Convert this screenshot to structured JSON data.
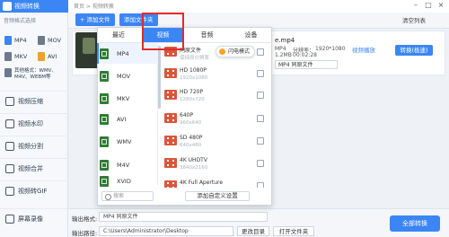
{
  "app": {
    "title": "视频转换",
    "breadcrumb": "首页 > 视频转换"
  },
  "window_controls": {
    "minimize": "–",
    "maximize": "□",
    "close": "×"
  },
  "sidebar": {
    "section_title": "音频格式选择",
    "formats": [
      {
        "label": "MP4",
        "color": "#3b86f4"
      },
      {
        "label": "MOV",
        "color": "#6c7a89"
      },
      {
        "label": "MKV",
        "color": "#6c7a89"
      },
      {
        "label": "AVI",
        "color": "#f0a030"
      },
      {
        "label": "其他格式：WMV、M4V、WEBM等",
        "color": "#6c7a89"
      }
    ],
    "nav": [
      {
        "label": "视频压缩",
        "icon": "compress-icon"
      },
      {
        "label": "视频水印",
        "icon": "watermark-icon"
      },
      {
        "label": "视频分割",
        "icon": "split-icon"
      },
      {
        "label": "视频合并",
        "icon": "merge-icon"
      },
      {
        "label": "视频转GIF",
        "icon": "gif-icon"
      },
      {
        "label": "屏幕录像",
        "icon": "record-icon"
      }
    ]
  },
  "toolbar": {
    "add_file": "+ 添加文件",
    "add_folder": "添加文件夹",
    "clear_list": "清空列表"
  },
  "file": {
    "name": "e.mp4",
    "format": "MP4",
    "resolution_label": "分辨率：",
    "resolution": "1920*1080",
    "duration": "00:02:28",
    "size": "1.2MB",
    "output_format": "MP4 同原文件",
    "play": "视频播放",
    "convert_one": "转换(极速)"
  },
  "popup": {
    "tabs": [
      "最近",
      "视频",
      "音频",
      "设备"
    ],
    "active_tab": "视频",
    "formats": [
      {
        "label": "MP4",
        "color": "#2e7d32"
      },
      {
        "label": "MOV",
        "color": "#2e7d32"
      },
      {
        "label": "MKV",
        "color": "#2e7d32"
      },
      {
        "label": "AVI",
        "color": "#2e7d32"
      },
      {
        "label": "WMV",
        "color": "#2e7d32"
      },
      {
        "label": "M4V",
        "color": "#2e7d32"
      },
      {
        "label": "XVID",
        "color": "#2e7d32"
      }
    ],
    "selected_format": "MP4",
    "resolutions": [
      {
        "name": "同原文件",
        "res": "保持原分辨率"
      },
      {
        "name": "HD 1080P",
        "res": "1920x1080"
      },
      {
        "name": "HD 720P",
        "res": "1280x720"
      },
      {
        "name": "640P",
        "res": "960x640"
      },
      {
        "name": "SD 480P",
        "res": "640x480"
      },
      {
        "name": "4K UHDTV",
        "res": "3840x2160"
      },
      {
        "name": "4K Full Aperture",
        "res": "4096x3112"
      }
    ],
    "flash_mode": "闪电模式",
    "search_placeholder": "搜索",
    "custom_button": "添加自定义设置"
  },
  "bottom": {
    "output_format_label": "输出格式:",
    "output_format_value": "MP4  同原文件",
    "output_path_label": "输出路径:",
    "output_path_value": "C:\\Users\\Administrator\\Desktop",
    "change_dir": "更改目录",
    "open_folder": "打开文件夹",
    "convert_all": "全部转换"
  }
}
